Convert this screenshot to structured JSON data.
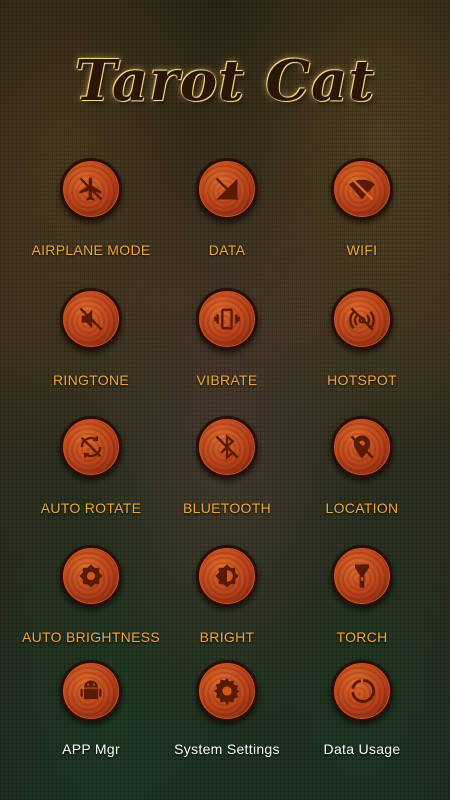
{
  "app_title": "Tarot Cat",
  "tiles": [
    {
      "label": "AIRPLANE MODE",
      "icon": "airplane-off-icon"
    },
    {
      "label": "DATA",
      "icon": "data-off-icon"
    },
    {
      "label": "WIFI",
      "icon": "wifi-off-icon"
    },
    {
      "label": "RINGTONE",
      "icon": "speaker-mute-icon"
    },
    {
      "label": "VIBRATE",
      "icon": "vibrate-icon"
    },
    {
      "label": "HOTSPOT",
      "icon": "hotspot-off-icon"
    },
    {
      "label": "AUTO ROTATE",
      "icon": "rotate-off-icon"
    },
    {
      "label": "BLUETOOTH",
      "icon": "bluetooth-off-icon"
    },
    {
      "label": "LOCATION",
      "icon": "location-off-icon"
    },
    {
      "label": "AUTO BRIGHTNESS",
      "icon": "auto-brightness-icon"
    },
    {
      "label": "BRIGHT",
      "icon": "brightness-icon"
    },
    {
      "label": "TORCH",
      "icon": "torch-icon"
    },
    {
      "label": "APP Mgr",
      "icon": "android-icon"
    },
    {
      "label": "System Settings",
      "icon": "gear-icon"
    },
    {
      "label": "Data Usage",
      "icon": "data-usage-icon"
    }
  ],
  "colors": {
    "accent": "#f2a43c",
    "white_label": "#ffffff",
    "button": "#b8401a"
  }
}
